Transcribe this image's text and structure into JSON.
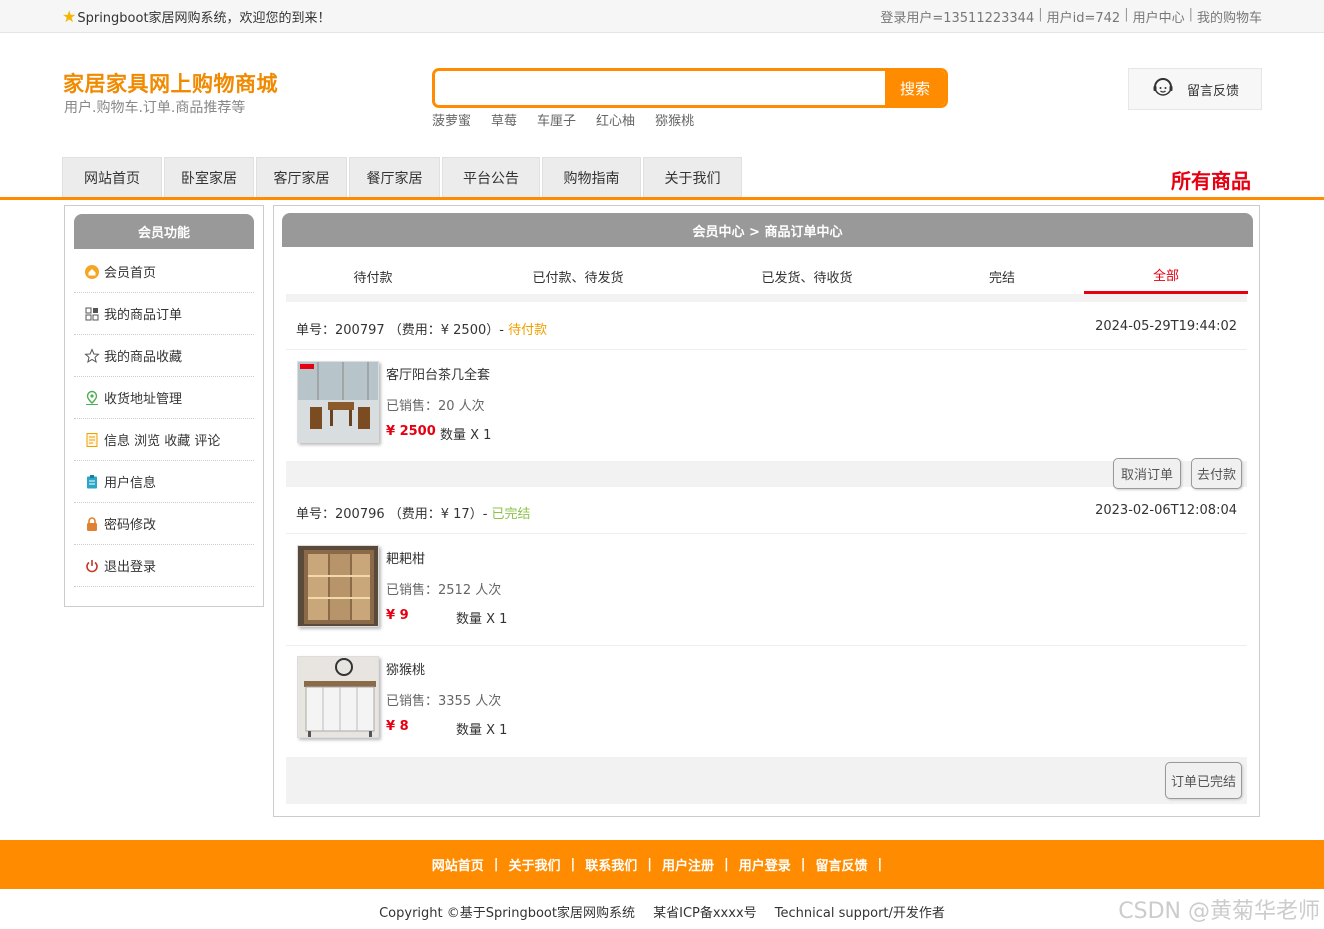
{
  "topbar": {
    "welcome": "Springboot家居网购系统，欢迎您的到来！",
    "links": [
      "登录用户=13511223344",
      "用户id=742",
      "用户中心",
      "我的购物车"
    ]
  },
  "header": {
    "title": "家居家具网上购物商城",
    "subtitle": "用户.购物车.订单.商品推荐等",
    "search_placeholder": "",
    "search_button": "搜索",
    "hot_words": [
      "菠萝蜜",
      "草莓",
      "车厘子",
      "红心柚",
      "猕猴桃"
    ],
    "feedback": "留言反馈"
  },
  "nav": {
    "tabs": [
      "网站首页",
      "卧室家居",
      "客厅家居",
      "餐厅家居",
      "平台公告",
      "购物指南",
      "关于我们"
    ],
    "all_goods": "所有商品"
  },
  "sidebar": {
    "title": "会员功能",
    "items": [
      {
        "label": "会员首页",
        "icon": "home-icon",
        "color": "#f5a623"
      },
      {
        "label": "我的商品订单",
        "icon": "grid-icon",
        "color": "#555555"
      },
      {
        "label": "我的商品收藏",
        "icon": "star-icon",
        "color": "#555555"
      },
      {
        "label": "收货地址管理",
        "icon": "location-icon",
        "color": "#4caf50"
      },
      {
        "label": "信息 浏览 收藏 评论",
        "icon": "document-icon",
        "color": "#f0a000"
      },
      {
        "label": "用户信息",
        "icon": "clipboard-icon",
        "color": "#2aa6c9"
      },
      {
        "label": "密码修改",
        "icon": "lock-icon",
        "color": "#e08030"
      },
      {
        "label": "退出登录",
        "icon": "power-icon",
        "color": "#c0392b"
      }
    ]
  },
  "main": {
    "title": "会员中心 > 商品订单中心",
    "status_tabs": [
      "待付款",
      "已付款、待发货",
      "已发货、待收货",
      "完结",
      "全部"
    ],
    "active_tab": "全部",
    "orders": [
      {
        "order_label": "单号：200797 （费用：¥ 2500）-",
        "status": "待付款",
        "date": "2024-05-29T19:44:02",
        "items": [
          {
            "name": "客厅阳台茶几全套",
            "sold": "已销售：20 人次",
            "price": "¥ 2500",
            "qty": "数量 X 1"
          }
        ],
        "buttons": [
          "取消订单",
          "去付款"
        ]
      },
      {
        "order_label": "单号：200796 （费用：¥ 17）-",
        "status": "已完结",
        "date": "2023-02-06T12:08:04",
        "items": [
          {
            "name": "耙耙柑",
            "sold": "已销售：2512 人次",
            "price": "¥ 9",
            "qty": "数量 X 1"
          },
          {
            "name": "猕猴桃",
            "sold": "已销售：3355 人次",
            "price": "¥ 8",
            "qty": "数量 X 1"
          }
        ],
        "buttons": [
          "订单已完结"
        ]
      }
    ]
  },
  "footer": {
    "links": [
      "网站首页",
      "关于我们",
      "联系我们",
      "用户注册",
      "用户登录",
      "留言反馈"
    ],
    "copyright": [
      "Copyright ©基于Springboot家居网购系统",
      "某省ICP备xxxx号",
      "Technical support/开发作者"
    ],
    "watermark": "CSDN @黄菊华老师"
  },
  "colors": {
    "accent": "#ff8c00",
    "active": "#e60012",
    "pending": "#f0a000",
    "done": "#8bc34a"
  }
}
